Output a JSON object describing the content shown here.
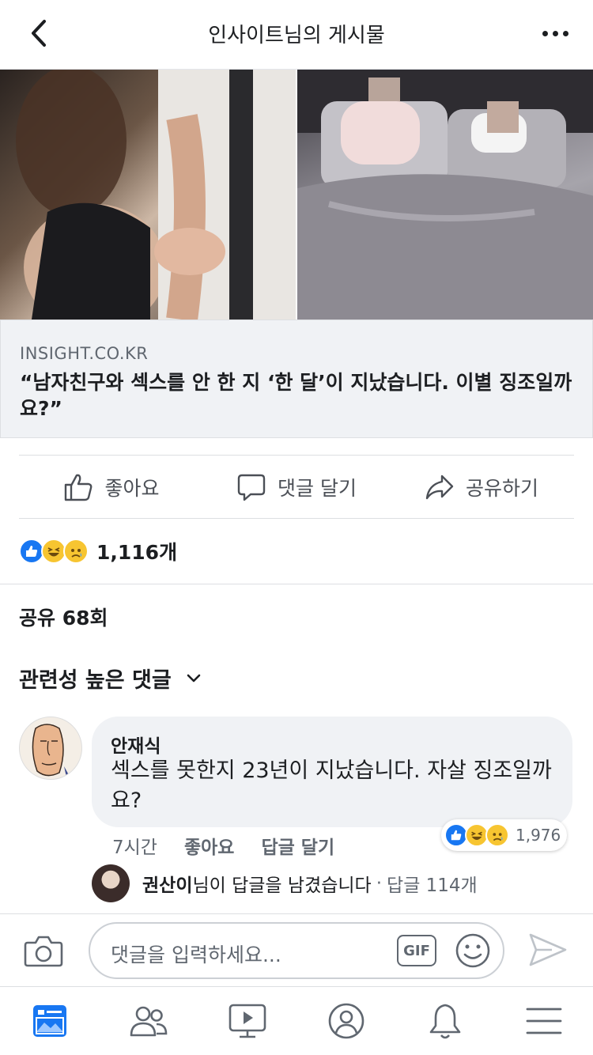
{
  "header": {
    "title": "인사이트님의 게시물"
  },
  "link": {
    "domain": "INSIGHT.CO.KR",
    "title": "“남자친구와 섹스를 안 한 지 ‘한 달’이 지났습니다. 이별 징조일까요?”"
  },
  "actions": {
    "like": "좋아요",
    "comment": "댓글 달기",
    "share": "공유하기"
  },
  "reactions": {
    "count": "1,116개",
    "icons": [
      "like-icon",
      "haha-icon",
      "sad-icon"
    ]
  },
  "shares": "공유 68회",
  "sort": {
    "label": "관련성 높은 댓글"
  },
  "comment": {
    "author": "안재식",
    "text": "섹스를 못한지 23년이 지났습니다. 자살 징조일까요?",
    "time": "7시간",
    "like_label": "좋아요",
    "reply_label": "답글 달기",
    "reaction_count": "1,976",
    "reply": {
      "name": "권산이",
      "suffix": "님이 답글을 남겼습니다",
      "separator": "·",
      "count": "답글 114개"
    }
  },
  "composer": {
    "placeholder": "댓글을 입력하세요...",
    "gif": "GIF"
  },
  "colors": {
    "accent": "#1877f2",
    "text": "#1c1e21",
    "secondary": "#606770",
    "bubble": "#f0f2f5"
  },
  "tabs": [
    "news-feed-icon",
    "friends-icon",
    "watch-icon",
    "profile-icon",
    "notifications-icon",
    "menu-icon"
  ]
}
